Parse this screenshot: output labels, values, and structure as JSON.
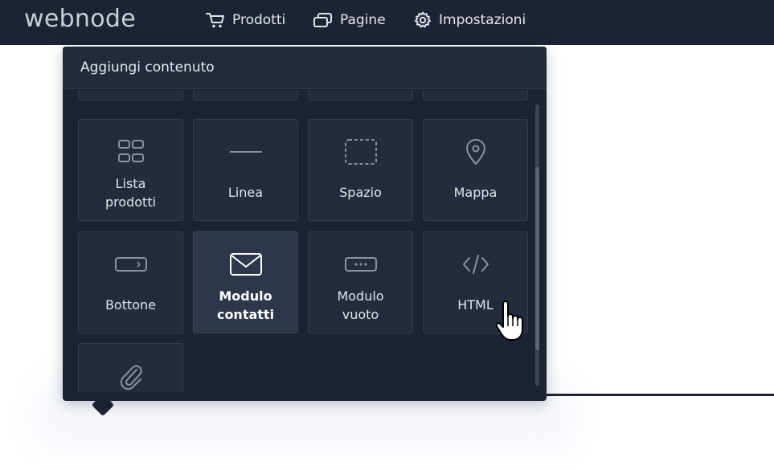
{
  "topbar": {
    "logo": "webnode",
    "nav": [
      {
        "label": "Prodotti",
        "icon": "cart-icon"
      },
      {
        "label": "Pagine",
        "icon": "pages-icon"
      },
      {
        "label": "Impostazioni",
        "icon": "gear-icon"
      }
    ]
  },
  "panel": {
    "title": "Aggiungi contenuto",
    "tiles": [
      {
        "label": "Lista\nprodotti",
        "icon": "product-list-icon"
      },
      {
        "label": "Linea",
        "icon": "line-icon"
      },
      {
        "label": "Spazio",
        "icon": "space-icon"
      },
      {
        "label": "Mappa",
        "icon": "map-pin-icon"
      },
      {
        "label": "Bottone",
        "icon": "button-icon"
      },
      {
        "label": "Modulo\ncontatti",
        "icon": "envelope-icon",
        "active": true
      },
      {
        "label": "Modulo\nvuoto",
        "icon": "empty-form-icon"
      },
      {
        "label": "HTML",
        "icon": "code-icon"
      },
      {
        "label": "",
        "icon": "paperclip-icon"
      }
    ]
  },
  "colors": {
    "topbar_bg": "#1d2333",
    "panel_bg": "#1d2333",
    "tile_bg": "#242b3c",
    "tile_active_bg": "#2e364a",
    "icon_color": "#8a93a6"
  }
}
